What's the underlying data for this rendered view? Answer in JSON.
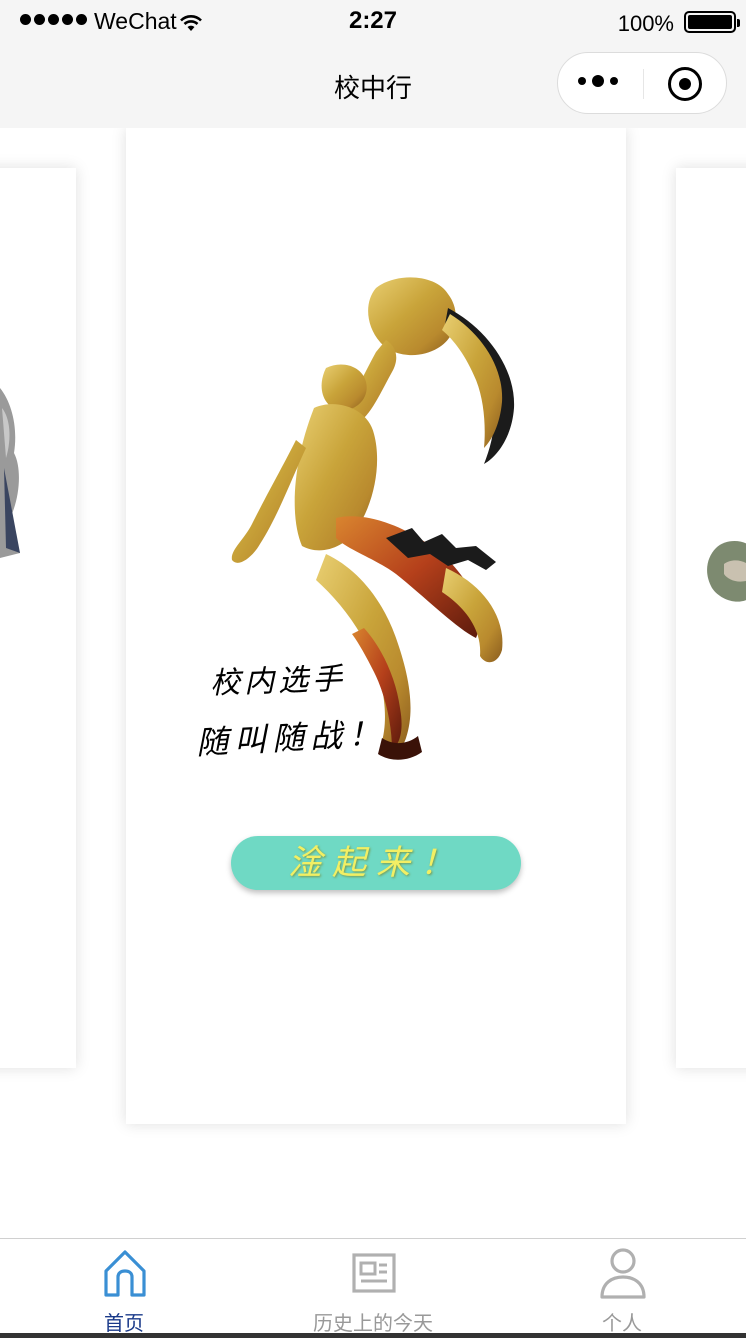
{
  "status_bar": {
    "carrier": "WeChat",
    "time": "2:27",
    "battery": "100%",
    "battery_level": 1.0,
    "signal_bars": 5
  },
  "nav": {
    "title": "校中行",
    "more_icon": "more-dots-icon",
    "close_icon": "close-miniprogram-icon"
  },
  "banner": {
    "slogan_line1": "校内选手",
    "slogan_line2": "随叫随战！",
    "cta_label": "淦起来！",
    "poster_icon": "basketball-dunk-silhouette",
    "colors": {
      "gold": "#c9a43a",
      "ember": "#b5401b",
      "cta": "#6fd9c4",
      "cta_text": "#f2ef64"
    }
  },
  "tabs": [
    {
      "label": "首页",
      "icon": "home-icon",
      "active": true,
      "color": "#1a3a8a"
    },
    {
      "label": "历史上的今天",
      "icon": "newspaper-icon",
      "active": false,
      "color": "#999999"
    },
    {
      "label": "个人",
      "icon": "user-icon",
      "active": false,
      "color": "#999999"
    }
  ]
}
